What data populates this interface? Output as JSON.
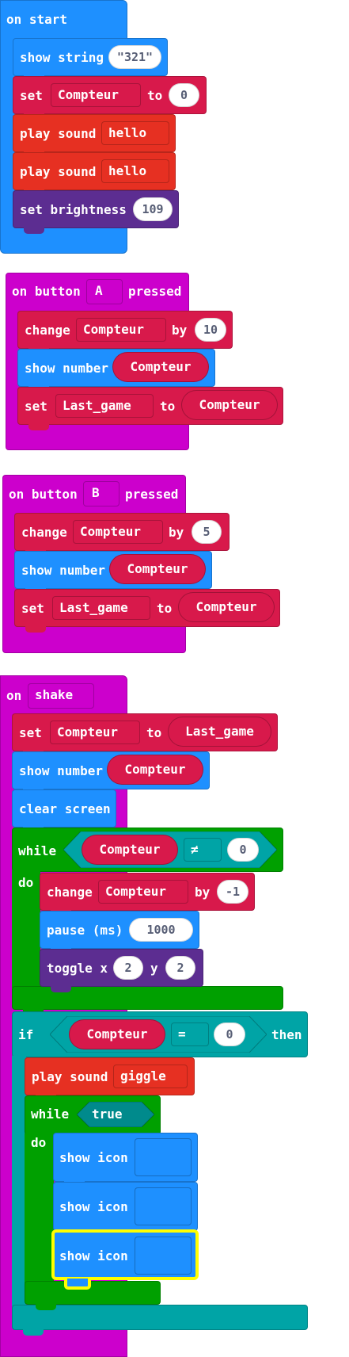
{
  "on_start": {
    "label": "on start",
    "show_string": {
      "label": "show string",
      "value": "\"321\""
    },
    "set_compteur": {
      "set": "set",
      "var": "Compteur",
      "to": "to",
      "value": "0"
    },
    "play_sound_1": {
      "label": "play sound",
      "sound": "hello"
    },
    "play_sound_2": {
      "label": "play sound",
      "sound": "hello"
    },
    "set_brightness": {
      "label": "set brightness",
      "value": "109"
    }
  },
  "button_a": {
    "on": "on button",
    "button": "A",
    "pressed": "pressed",
    "change": {
      "label": "change",
      "var": "Compteur",
      "by": "by",
      "value": "10"
    },
    "show_number": {
      "label": "show number",
      "value": "Compteur"
    },
    "set_last": {
      "set": "set",
      "var": "Last_game",
      "to": "to",
      "value": "Compteur"
    }
  },
  "button_b": {
    "on": "on button",
    "button": "B",
    "pressed": "pressed",
    "change": {
      "label": "change",
      "var": "Compteur",
      "by": "by",
      "value": "5"
    },
    "show_number": {
      "label": "show number",
      "value": "Compteur"
    },
    "set_last": {
      "set": "set",
      "var": "Last_game",
      "to": "to",
      "value": "Compteur"
    }
  },
  "shake": {
    "on": "on",
    "event": "shake",
    "set_compteur": {
      "set": "set",
      "var": "Compteur",
      "to": "to",
      "value": "Last_game"
    },
    "show_number": {
      "label": "show number",
      "value": "Compteur"
    },
    "clear_screen": "clear screen",
    "while1": {
      "while": "while",
      "left": "Compteur",
      "op": "≠",
      "right": "0",
      "do": "do"
    },
    "change": {
      "label": "change",
      "var": "Compteur",
      "by": "by",
      "value": "-1"
    },
    "pause": {
      "label": "pause (ms)",
      "value": "1000"
    },
    "toggle": {
      "label": "toggle x",
      "x": "2",
      "y_label": "y",
      "y": "2"
    },
    "if": {
      "if": "if",
      "left": "Compteur",
      "op": "=",
      "right": "0",
      "then": "then"
    },
    "play_sound": {
      "label": "play sound",
      "sound": "giggle"
    },
    "while2": {
      "while": "while",
      "cond": "true",
      "do": "do"
    },
    "show_icon_1": "show icon",
    "show_icon_2": "show icon",
    "show_icon_3": "show icon"
  },
  "colors": {
    "basic": "#1e90ff",
    "variables": "#d8194b",
    "music": "#e63022",
    "led": "#5c2d91",
    "input": "#cc00cc",
    "loops": "#00a000",
    "logic": "#00a4a6",
    "selection": "#ffff00"
  }
}
